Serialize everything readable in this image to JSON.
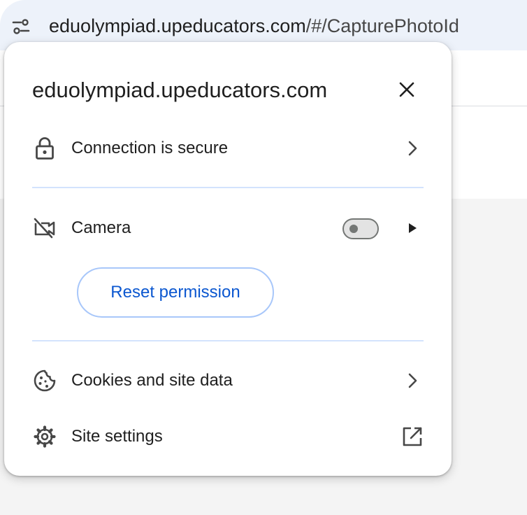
{
  "omnibox": {
    "host": "eduolympiad.upeducators.com",
    "path": "/#/CapturePhotoId",
    "site_info_icon": "tune-icon"
  },
  "page_info": {
    "title": "eduolympiad.upeducators.com",
    "close_icon": "close-icon",
    "connection": {
      "label": "Connection is secure",
      "icon": "lock-icon",
      "trailing_icon": "chevron-right-icon"
    },
    "camera": {
      "label": "Camera",
      "icon": "camera-off-icon",
      "enabled": false,
      "expand_icon": "triangle-right-icon",
      "reset_label": "Reset permission"
    },
    "cookies": {
      "label": "Cookies and site data",
      "icon": "cookie-icon",
      "trailing_icon": "chevron-right-icon"
    },
    "site_settings": {
      "label": "Site settings",
      "icon": "gear-icon",
      "trailing_icon": "open-in-new-icon"
    }
  },
  "colors": {
    "omnibox_bg": "#edf2fa",
    "accent": "#0b57d0",
    "divider": "#d3e3fd",
    "text": "#1f1f1f"
  }
}
